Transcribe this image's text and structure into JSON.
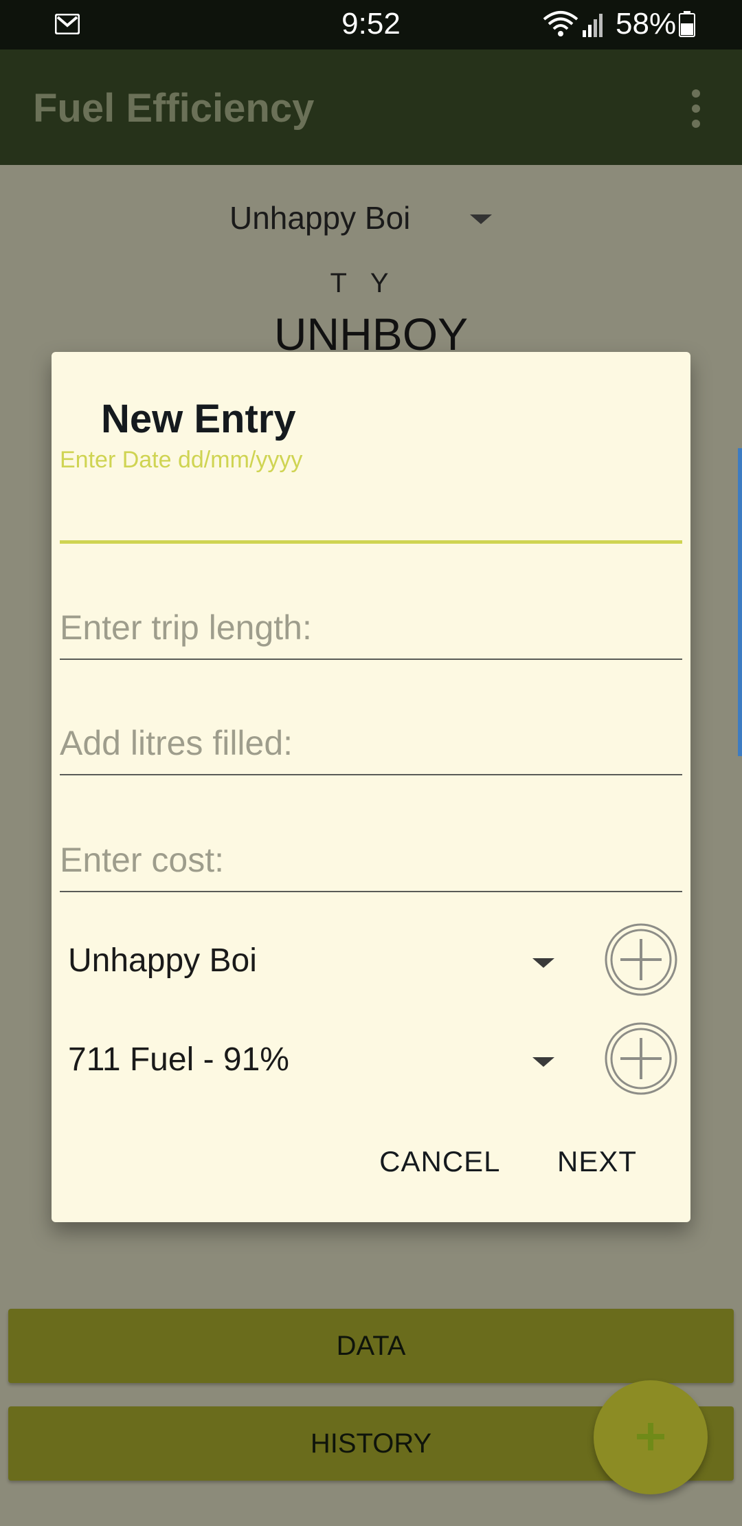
{
  "status_bar": {
    "time": "9:52",
    "battery": "58%",
    "icons": [
      "gmail-icon",
      "wifi-icon",
      "signal-icon",
      "battery-icon"
    ]
  },
  "app_bar": {
    "title": "Fuel Efficiency",
    "overflow_icon": "more-vert-icon"
  },
  "background": {
    "vehicle_selector": "Unhappy Boi",
    "letters": "TY",
    "plate": "UNHBOY",
    "buttons": {
      "data": "DATA",
      "history": "HISTORY"
    },
    "fab_icon": "plus-icon"
  },
  "dialog": {
    "title": "New Entry",
    "date_label": "Enter Date dd/mm/yyyy",
    "date_value": "",
    "trip_length_placeholder": "Enter trip length:",
    "litres_placeholder": "Add litres filled:",
    "cost_placeholder": "Enter cost:",
    "vehicle_spinner": "Unhappy Boi",
    "fuel_spinner": "711 Fuel - 91%",
    "cancel_label": "CANCEL",
    "next_label": "NEXT"
  },
  "colors": {
    "status_bar": "#0e130c",
    "app_bar": "#26321a",
    "scrim_background": "#8c8b7a",
    "dialog_background": "#fdf9e2",
    "accent": "#cfd452",
    "bottom_button": "#6a6c1c",
    "fab": "#8c8c24"
  }
}
